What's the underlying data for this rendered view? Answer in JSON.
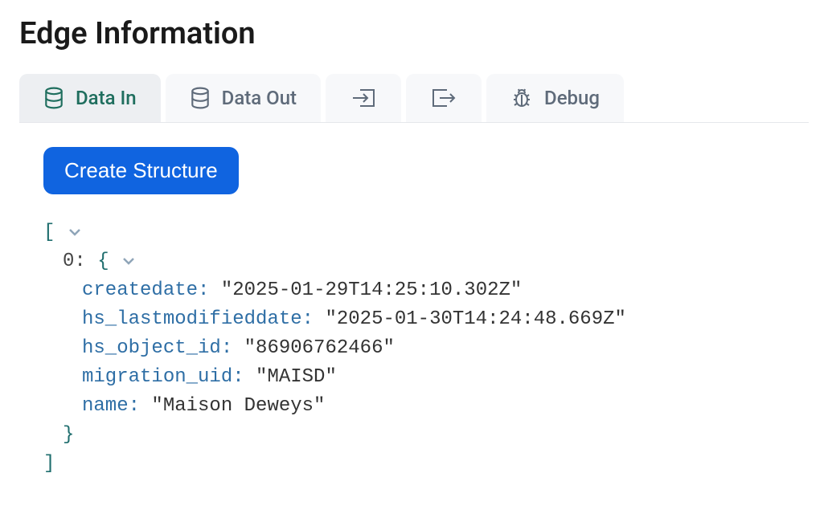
{
  "header": {
    "title": "Edge Information"
  },
  "tabs": {
    "data_in": "Data In",
    "data_out": "Data Out",
    "debug": "Debug"
  },
  "actions": {
    "create_structure": "Create Structure"
  },
  "json": {
    "open_array": "[",
    "close_array": "]",
    "item0": {
      "index_label": "0:",
      "open_brace": "{",
      "close_brace": "}",
      "createdate_key": "createdate:",
      "createdate_value": "\"2025-01-29T14:25:10.302Z\"",
      "hs_lastmodifieddate_key": "hs_lastmodifieddate:",
      "hs_lastmodifieddate_value": "\"2025-01-30T14:24:48.669Z\"",
      "hs_object_id_key": "hs_object_id:",
      "hs_object_id_value": "\"86906762466\"",
      "migration_uid_key": "migration_uid:",
      "migration_uid_value": "\"MAISD\"",
      "name_key": "name:",
      "name_value": "\"Maison Deweys\""
    }
  }
}
